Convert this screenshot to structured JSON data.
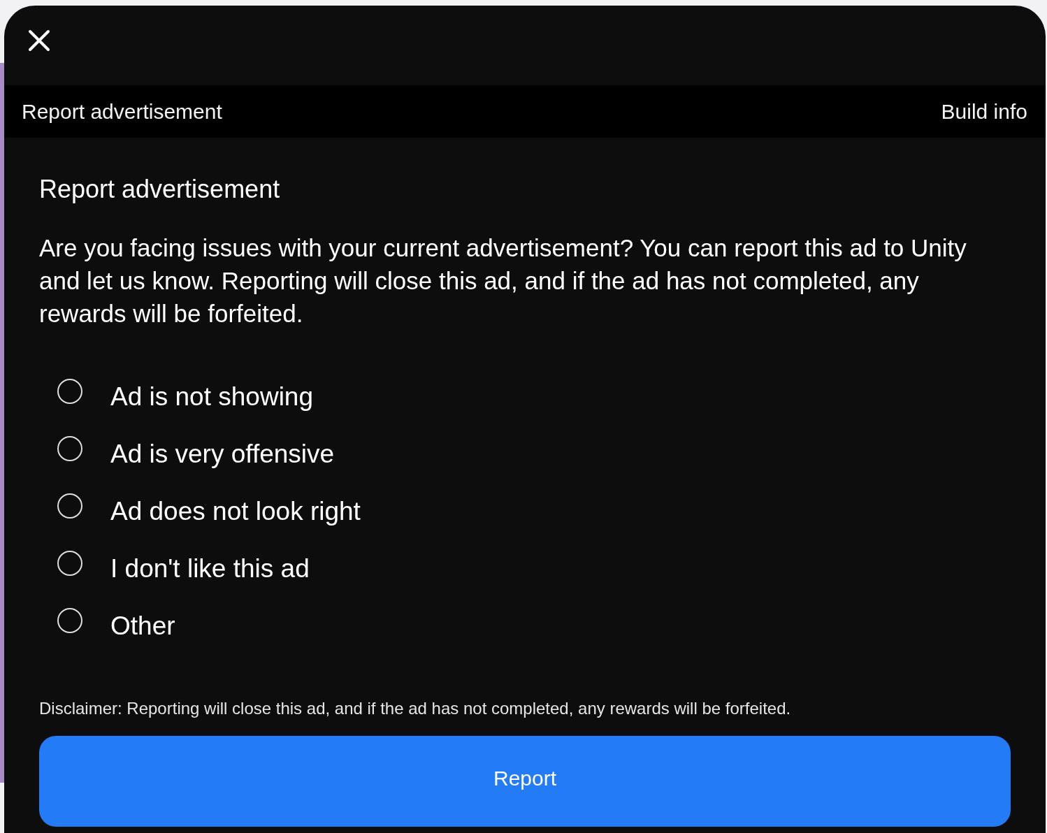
{
  "header": {
    "title": "Report advertisement",
    "build_info": "Build info"
  },
  "content": {
    "title": "Report advertisement",
    "description": "Are you facing issues with your current advertisement? You can report this ad to Unity and let us know. Reporting will close this ad, and if the ad has not completed, any rewards will be forfeited.",
    "options": [
      {
        "label": "Ad is not showing",
        "selected": false
      },
      {
        "label": "Ad is very offensive",
        "selected": false
      },
      {
        "label": "Ad does not look right",
        "selected": false
      },
      {
        "label": "I don't like this ad",
        "selected": false
      },
      {
        "label": "Other",
        "selected": false
      }
    ],
    "disclaimer": "Disclaimer: Reporting will close this ad, and if the ad has not completed, any rewards will be forfeited.",
    "button": "Report"
  }
}
